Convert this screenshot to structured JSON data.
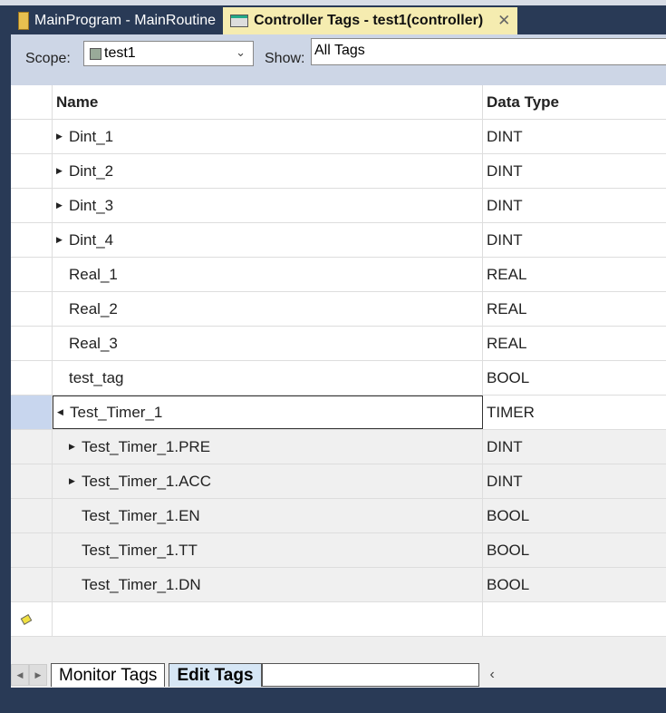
{
  "tabs": [
    {
      "label": "MainProgram - MainRoutine",
      "icon": "ladder-icon"
    },
    {
      "label": "Controller Tags - test1(controller)",
      "icon": "tag-table-icon",
      "active": true,
      "close": "✕"
    }
  ],
  "toolbar": {
    "scope_label": "Scope:",
    "scope_value": "test1",
    "show_label": "Show:",
    "show_value": "All Tags"
  },
  "table": {
    "headers": [
      "Name",
      "Data Type"
    ],
    "rows": [
      {
        "name": "Dint_1",
        "type": "DINT",
        "expander": "▶"
      },
      {
        "name": "Dint_2",
        "type": "DINT",
        "expander": "▶"
      },
      {
        "name": "Dint_3",
        "type": "DINT",
        "expander": "▶"
      },
      {
        "name": "Dint_4",
        "type": "DINT",
        "expander": "▶"
      },
      {
        "name": "Real_1",
        "type": "REAL"
      },
      {
        "name": "Real_2",
        "type": "REAL"
      },
      {
        "name": "Real_3",
        "type": "REAL"
      },
      {
        "name": "test_tag",
        "type": "BOOL"
      },
      {
        "name": "Test_Timer_1",
        "type": "TIMER",
        "expander": "◀"
      },
      {
        "name": "Test_Timer_1.PRE",
        "type": "DINT",
        "expander": "▶"
      },
      {
        "name": "Test_Timer_1.ACC",
        "type": "DINT",
        "expander": "▶"
      },
      {
        "name": "Test_Timer_1.EN",
        "type": "BOOL"
      },
      {
        "name": "Test_Timer_1.TT",
        "type": "BOOL"
      },
      {
        "name": "Test_Timer_1.DN",
        "type": "BOOL"
      }
    ]
  },
  "bottom_tabs": [
    "Monitor Tags",
    "Edit Tags"
  ],
  "nav": {
    "prev": "◀",
    "next": "▶",
    "scroll_left": "‹"
  }
}
